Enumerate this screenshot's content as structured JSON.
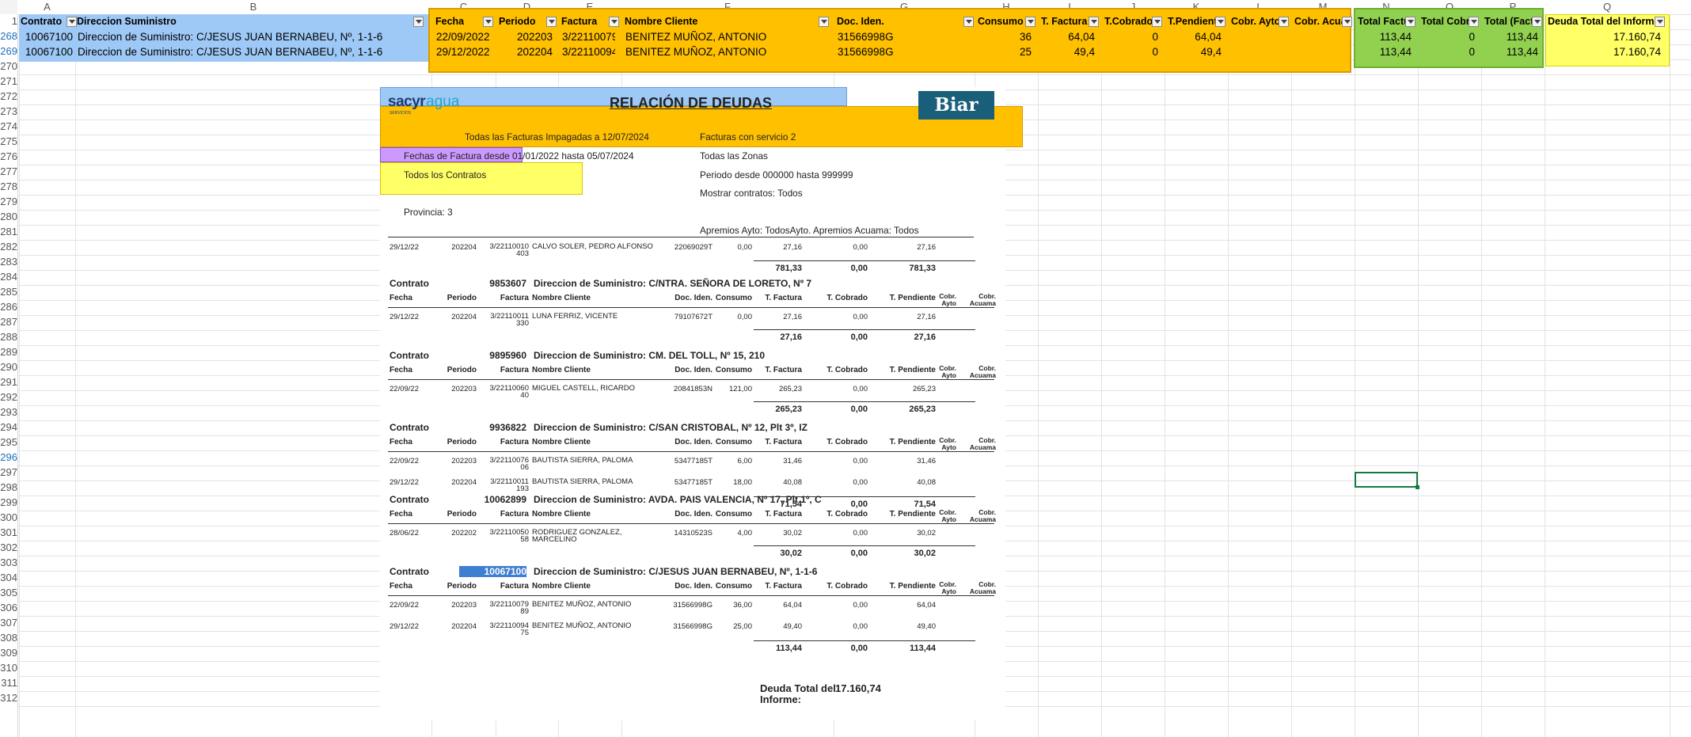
{
  "sheet": {
    "columns": [
      "A",
      "B",
      "C",
      "D",
      "E",
      "F",
      "G",
      "H",
      "I",
      "J",
      "K",
      "L",
      "M",
      "N",
      "O",
      "P",
      "Q"
    ],
    "rows": [
      "1",
      "268",
      "269",
      "270",
      "271",
      "272",
      "273",
      "274",
      "275",
      "276",
      "277",
      "278",
      "279",
      "280",
      "281",
      "282",
      "283",
      "284",
      "285",
      "286",
      "287",
      "288",
      "289",
      "290",
      "291",
      "292",
      "293",
      "294",
      "295",
      "296",
      "297",
      "298",
      "299",
      "300",
      "301",
      "302",
      "303",
      "304",
      "305",
      "306",
      "307",
      "308",
      "309",
      "310",
      "311",
      "312"
    ],
    "headers": {
      "contrato": "Contrato",
      "direccion": "Direccion Suministro",
      "fecha": "Fecha",
      "periodo": "Periodo",
      "factura": "Factura",
      "nombre": "Nombre Cliente",
      "doc": "Doc. Iden.",
      "consumo": "Consumo",
      "tfactura": "T. Factura",
      "tcobrado": "T.Cobrado",
      "tpendiente": "T.Pendiente",
      "cobrayto": "Cobr. Ayto",
      "cobracuama": "Cobr. Acuama",
      "totalfactura": "Total Factura",
      "totalcobrado": "Total Cobrado",
      "totalfactp": "Total (Factura)",
      "deudatotal": "Deuda Total del Informe:"
    },
    "data_rows": [
      {
        "contrato": "10067100",
        "direccion": "Direccion de Suministro: C/JESUS JUAN BERNABEU, Nº, 1-1-6",
        "fecha": "22/09/2022",
        "periodo": "202203",
        "factura": "3/2211007989",
        "nombre": "BENITEZ MUÑOZ, ANTONIO",
        "doc": "31566998G",
        "consumo": "36",
        "tfactura": "64,04",
        "tcobrado": "0",
        "tpendiente": "64,04",
        "totalfactura": "113,44",
        "totalcobrado": "0",
        "totalfactp": "113,44",
        "deudatotal": "17.160,74"
      },
      {
        "contrato": "10067100",
        "direccion": "Direccion de Suministro: C/JESUS JUAN BERNABEU, Nº, 1-1-6",
        "fecha": "29/12/2022",
        "periodo": "202204",
        "factura": "3/2211009475",
        "nombre": "BENITEZ MUÑOZ, ANTONIO",
        "doc": "31566998G",
        "consumo": "25",
        "tfactura": "49,4",
        "tcobrado": "0",
        "tpendiente": "49,4",
        "totalfactura": "113,44",
        "totalcobrado": "0",
        "totalfactp": "113,44",
        "deudatotal": "17.160,74"
      }
    ]
  },
  "report": {
    "logo_brand": "sacyr",
    "logo_product": "agua",
    "logo_sub": "SERVICIOS",
    "title": "RELACIÓN DE DEUDAS",
    "badge": "Biar",
    "filters_left": [
      "Todas las Facturas Impagadas a 12/07/2024",
      "Fechas de Factura desde 01/01/2022 hasta 05/07/2024",
      "Todos los Contratos",
      "Provincia: 3"
    ],
    "filters_right": [
      "Facturas con servicio 2",
      "Todas las Zonas",
      "Periodo desde 000000 hasta 999999",
      "Mostrar contratos: Todos",
      "Apremios Ayto: TodosAyto. Apremios Acuama: Todos"
    ],
    "col_labels": {
      "fecha": "Fecha",
      "periodo": "Periodo",
      "factura": "Factura",
      "nombre": "Nombre Cliente",
      "doc": "Doc. Iden.",
      "consumo": "Consumo",
      "tfactura": "T. Factura",
      "tcobrado": "T. Cobrado",
      "tpendiente": "T. Pendiente",
      "cobrayto": "Cobr. Ayto",
      "cobracuama": "Cobr. Acuama"
    },
    "contrato_label": "Contrato",
    "prev_row": {
      "fecha": "29/12/22",
      "periodo": "202204",
      "factura": "3/22110010 403",
      "nombre": "CALVO SOLER, PEDRO ALFONSO",
      "doc": "22069029T",
      "consumo": "0,00",
      "tfactura": "27,16",
      "tcobrado": "0,00",
      "tpendiente": "27,16"
    },
    "prev_totals": {
      "tfactura": "781,33",
      "tcobrado": "0,00",
      "tpendiente": "781,33"
    },
    "contracts": [
      {
        "num": "9853607",
        "dir": "Direccion de Suministro:  C/NTRA. SEÑORA DE LORETO, Nº 7",
        "rows": [
          {
            "fecha": "29/12/22",
            "periodo": "202204",
            "factura": "3/22110011 330",
            "nombre": "LUNA FERRIZ, VICENTE",
            "doc": "79107672T",
            "consumo": "0,00",
            "tfactura": "27,16",
            "tcobrado": "0,00",
            "tpendiente": "27,16"
          }
        ],
        "totals": {
          "tfactura": "27,16",
          "tcobrado": "0,00",
          "tpendiente": "27,16"
        }
      },
      {
        "num": "9895960",
        "dir": "Direccion de Suministro:  CM. DEL TOLL, Nº 15, 210",
        "rows": [
          {
            "fecha": "22/09/22",
            "periodo": "202203",
            "factura": "3/22110060 40",
            "nombre": "MIGUEL CASTELL, RICARDO",
            "doc": "20841853N",
            "consumo": "121,00",
            "tfactura": "265,23",
            "tcobrado": "0,00",
            "tpendiente": "265,23"
          }
        ],
        "totals": {
          "tfactura": "265,23",
          "tcobrado": "0,00",
          "tpendiente": "265,23"
        }
      },
      {
        "num": "9936822",
        "dir": "Direccion de Suministro: C/SAN CRISTOBAL, Nº 12, Plt 3º, IZ",
        "rows": [
          {
            "fecha": "22/09/22",
            "periodo": "202203",
            "factura": "3/22110076 06",
            "nombre": "BAUTISTA SIERRA, PALOMA",
            "doc": "53477185T",
            "consumo": "6,00",
            "tfactura": "31,46",
            "tcobrado": "0,00",
            "tpendiente": "31,46"
          },
          {
            "fecha": "29/12/22",
            "periodo": "202204",
            "factura": "3/22110011 193",
            "nombre": "BAUTISTA SIERRA, PALOMA",
            "doc": "53477185T",
            "consumo": "18,00",
            "tfactura": "40,08",
            "tcobrado": "0,00",
            "tpendiente": "40,08"
          }
        ],
        "totals": {
          "tfactura": "71,54",
          "tcobrado": "0,00",
          "tpendiente": "71,54"
        }
      },
      {
        "num": "10062899",
        "dir": "Direccion de Suministro: AVDA. PAIS VALENCIA, Nº 17, Plt 1º, C",
        "rows": [
          {
            "fecha": "28/06/22",
            "periodo": "202202",
            "factura": "3/22110050 58",
            "nombre": "RODRIGUEZ GONZALEZ, MARCELINO",
            "doc": "14310523S",
            "consumo": "4,00",
            "tfactura": "30,02",
            "tcobrado": "0,00",
            "tpendiente": "30,02"
          }
        ],
        "totals": {
          "tfactura": "30,02",
          "tcobrado": "0,00",
          "tpendiente": "30,02"
        }
      },
      {
        "num": "10067100",
        "dir": "Direccion de Suministro: C/JESUS JUAN BERNABEU, Nº, 1-1-6",
        "rows": [
          {
            "fecha": "22/09/22",
            "periodo": "202203",
            "factura": "3/22110079 89",
            "nombre": "BENITEZ MUÑOZ, ANTONIO",
            "doc": "31566998G",
            "consumo": "36,00",
            "tfactura": "64,04",
            "tcobrado": "0,00",
            "tpendiente": "64,04"
          },
          {
            "fecha": "29/12/22",
            "periodo": "202204",
            "factura": "3/22110094 75",
            "nombre": "BENITEZ MUÑOZ, ANTONIO",
            "doc": "31566998G",
            "consumo": "25,00",
            "tfactura": "49,40",
            "tcobrado": "0,00",
            "tpendiente": "49,40"
          }
        ],
        "totals": {
          "tfactura": "113,44",
          "tcobrado": "0,00",
          "tpendiente": "113,44"
        }
      }
    ],
    "grand_total_label_1": "Deuda Total del",
    "grand_total_label_2": "Informe:",
    "grand_total_value": "17.160,74"
  },
  "colors": {
    "blue_band": "#9ec9f7",
    "orange_band": "#ffc000",
    "green_band": "#92d050",
    "yellow_band": "#ffff66",
    "purple_band": "#cc99ff",
    "badge_bg": "#1a5f7a"
  }
}
